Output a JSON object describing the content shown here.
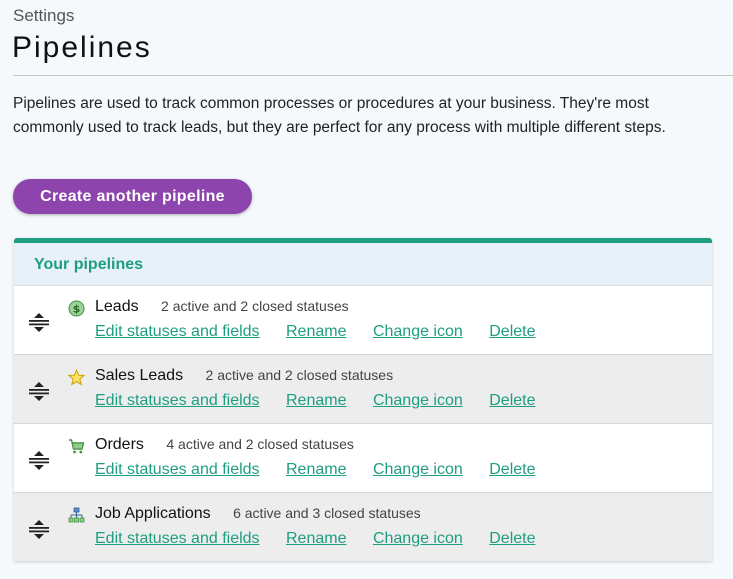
{
  "breadcrumb": "Settings",
  "page_title": "Pipelines",
  "intro": "Pipelines are used to track common processes or procedures at your business. They're most commonly used to track leads, but they are perfect for any process with multiple different steps.",
  "create_button_label": "Create another pipeline",
  "panel": {
    "title": "Your pipelines",
    "actions": {
      "edit": "Edit statuses and fields",
      "rename": "Rename",
      "change_icon": "Change icon",
      "delete": "Delete"
    },
    "items": [
      {
        "name": "Leads",
        "status": "2 active and 2 closed statuses",
        "icon": "dollar-icon"
      },
      {
        "name": "Sales Leads",
        "status": "2 active and 2 closed statuses",
        "icon": "star-icon"
      },
      {
        "name": "Orders",
        "status": "4 active and 2 closed statuses",
        "icon": "cart-icon"
      },
      {
        "name": "Job Applications",
        "status": "6 active and 3 closed statuses",
        "icon": "org-chart-icon"
      }
    ]
  },
  "colors": {
    "accent": "#1e9e81",
    "button": "#8e44ad",
    "header_bg": "#e7f1f7",
    "alt_row": "#ededed"
  }
}
